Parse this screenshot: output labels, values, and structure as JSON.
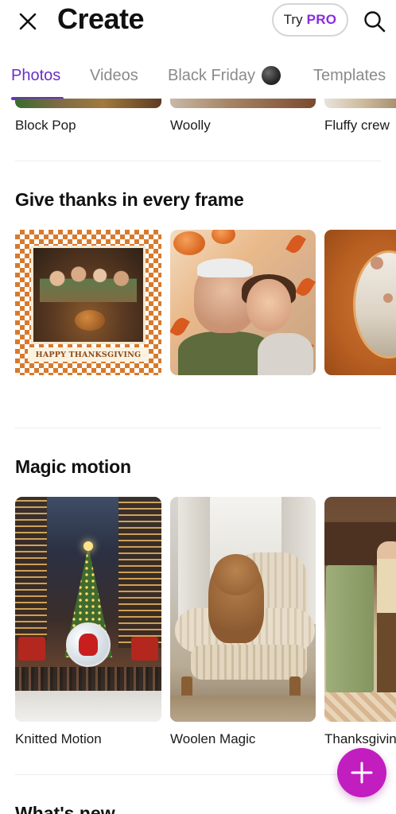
{
  "header": {
    "title": "Create",
    "try_label": "Try",
    "pro_label": "PRO",
    "close_icon": "close-icon",
    "search_icon": "search-icon"
  },
  "tabs": [
    {
      "label": "Photos",
      "active": true
    },
    {
      "label": "Videos",
      "active": false
    },
    {
      "label": "Black Friday",
      "active": false
    },
    {
      "label": "Templates",
      "active": false
    }
  ],
  "styles_row": {
    "items": [
      {
        "label": "Block Pop"
      },
      {
        "label": "Woolly"
      },
      {
        "label": "Fluffy crew"
      }
    ]
  },
  "sections": [
    {
      "title": "Give thanks in every frame",
      "cards": [
        {
          "banner": "HAPPY THANKSGIVING"
        },
        {},
        {}
      ]
    },
    {
      "title": "Magic motion",
      "cards": [
        {
          "label": "Knitted Motion"
        },
        {
          "label": "Woolen Magic"
        },
        {
          "label": "Thanksgiving"
        }
      ]
    },
    {
      "title": "What's new"
    }
  ],
  "colors": {
    "accent_purple": "#6b2fc5",
    "pro_purple": "#8a2be2",
    "fab_magenta": "#c21ebf"
  },
  "fab": {
    "icon": "plus-icon"
  }
}
